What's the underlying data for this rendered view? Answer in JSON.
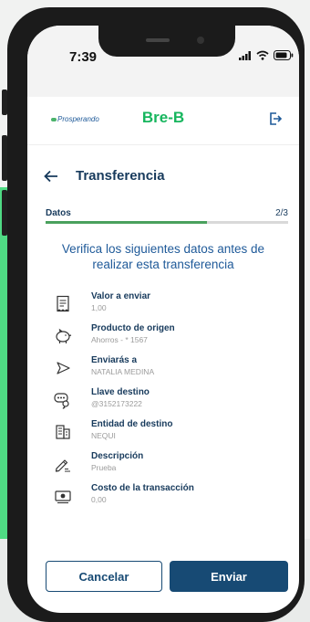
{
  "status": {
    "time": "7:39"
  },
  "app": {
    "brand_left": "Prosperando",
    "brand_center": "Bre-B"
  },
  "header": {
    "title": "Transferencia"
  },
  "progress": {
    "label": "Datos",
    "step": "2/3",
    "fraction": 0.667
  },
  "instruction": "Verifica los siguientes datos antes de realizar esta transferencia",
  "details": [
    {
      "label": "Valor a enviar",
      "value": "1,00",
      "icon": "receipt-icon"
    },
    {
      "label": "Producto de origen",
      "value": "Ahorros - * 1567",
      "icon": "piggy-bank-icon"
    },
    {
      "label": "Enviarás a",
      "value": "NATALIA MEDINA",
      "icon": "send-arrow-icon"
    },
    {
      "label": "Llave destino",
      "value": "@3152173222",
      "icon": "key-icon"
    },
    {
      "label": "Entidad de destino",
      "value": "NEQUI",
      "icon": "building-icon"
    },
    {
      "label": "Descripción",
      "value": "Prueba",
      "icon": "edit-icon"
    },
    {
      "label": "Costo de la transacción",
      "value": "0,00",
      "icon": "cash-icon"
    }
  ],
  "actions": {
    "cancel": "Cancelar",
    "send": "Enviar"
  },
  "colors": {
    "navy": "#174a74",
    "green": "#17b65e",
    "progress": "#4aa15d"
  }
}
